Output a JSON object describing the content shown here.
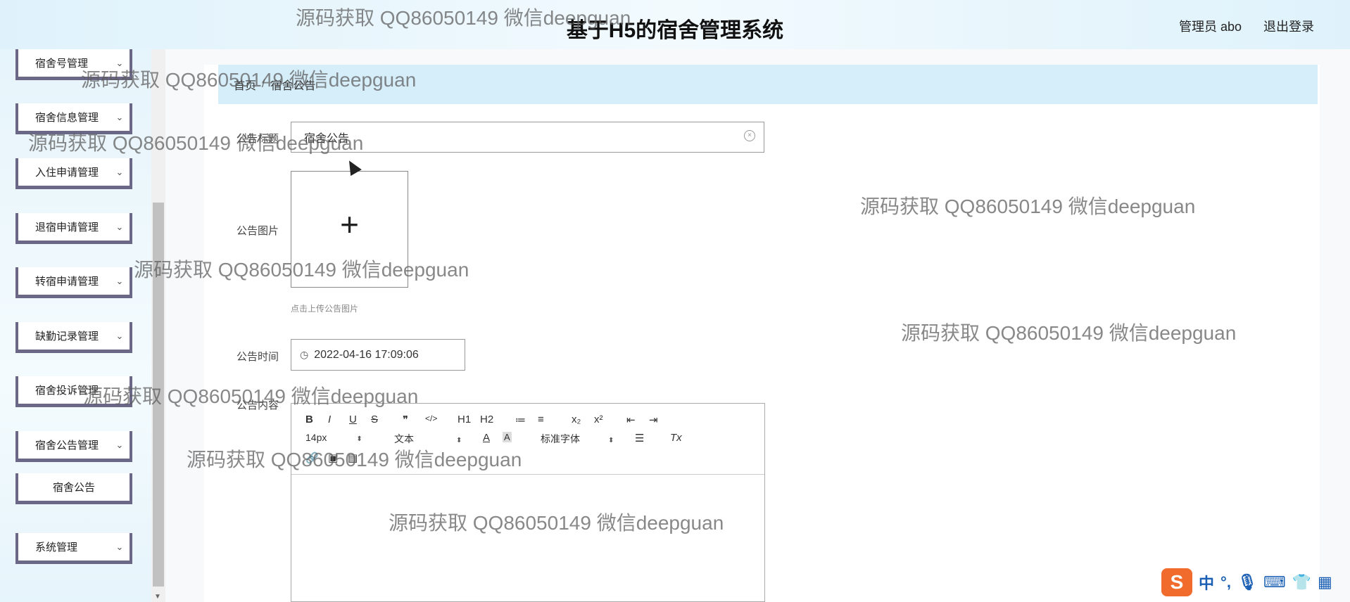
{
  "header": {
    "title": "基于H5的宿舍管理系统",
    "admin_label": "管理员 abo",
    "logout_label": "退出登录"
  },
  "sidebar": {
    "items": [
      {
        "label": "宿舍号管理"
      },
      {
        "label": "宿舍信息管理"
      },
      {
        "label": "入住申请管理"
      },
      {
        "label": "退宿申请管理"
      },
      {
        "label": "转宿申请管理"
      },
      {
        "label": "缺勤记录管理"
      },
      {
        "label": "宿舍投诉管理"
      },
      {
        "label": "宿舍公告管理"
      },
      {
        "label": "宿舍公告"
      },
      {
        "label": "系统管理"
      }
    ],
    "chevron_icon": "chevron-down-icon"
  },
  "breadcrumb": {
    "home": "首页",
    "separator": "/",
    "current": "宿舍公告"
  },
  "form": {
    "title_label": "公告标题",
    "title_value": "宿舍公告",
    "image_label": "公告图片",
    "upload_hint": "点击上传公告图片",
    "time_label": "公告时间",
    "time_value": "2022-04-16 17:09:06",
    "content_label": "公告内容"
  },
  "editor": {
    "toolbar_row1": [
      "B",
      "I",
      "U",
      "S",
      "❞",
      "</>",
      "H1",
      "H2",
      "≔",
      "≡",
      "x₂",
      "x²",
      "⇤",
      "⇥"
    ],
    "font_size": "14px",
    "text_style": "文本",
    "font_family": "标准字体",
    "color_tool": "A",
    "clear_format": "Tx"
  },
  "watermark": "源码获取 QQ86050149 微信deepguan",
  "ime": {
    "logo": "S",
    "items": [
      "中",
      "°,",
      "🎙",
      "⌨",
      "👕",
      "▦"
    ]
  },
  "colors": {
    "header_bg": "#dff2fb",
    "breadcrumb_bg": "#d6eefa",
    "menu_border": "#6b6887",
    "ime_orange": "#f06b2c"
  }
}
